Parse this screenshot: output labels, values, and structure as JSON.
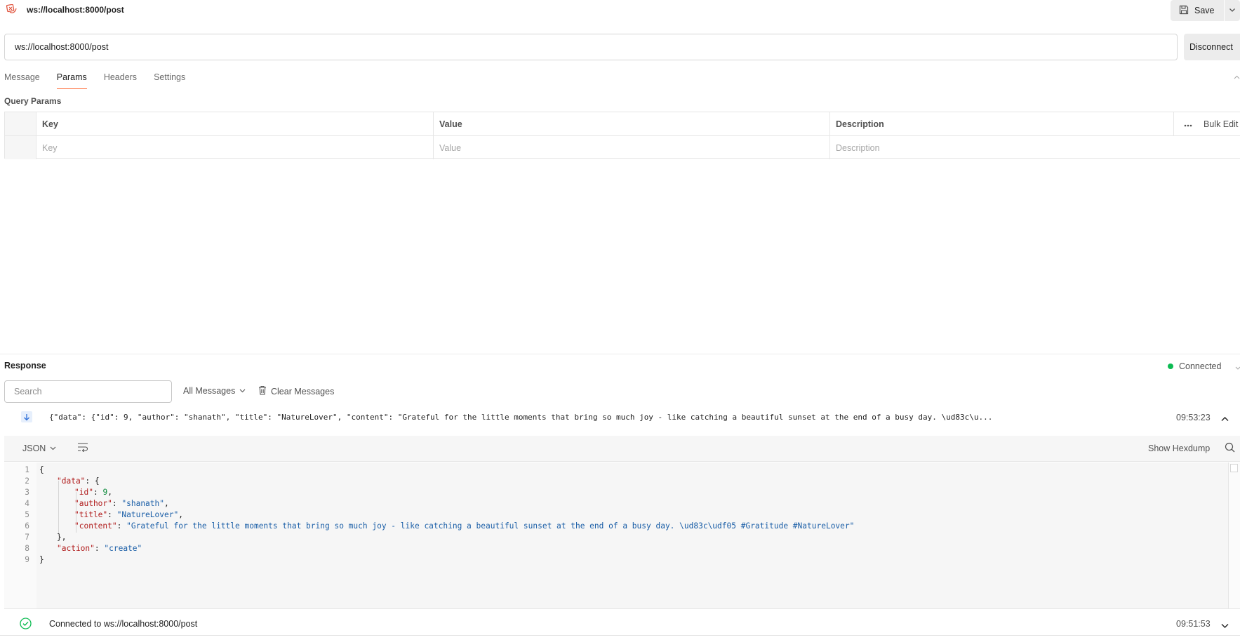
{
  "header": {
    "title": "ws://localhost:8000/post",
    "save_label": "Save"
  },
  "url_bar": {
    "value": "ws://localhost:8000/post",
    "disconnect_label": "Disconnect"
  },
  "tabs": [
    {
      "label": "Message"
    },
    {
      "label": "Params",
      "active": true
    },
    {
      "label": "Headers"
    },
    {
      "label": "Settings"
    }
  ],
  "params": {
    "section_label": "Query Params",
    "columns": [
      "Key",
      "Value",
      "Description"
    ],
    "bulk_edit_label": "Bulk Edit",
    "placeholders": {
      "key": "Key",
      "value": "Value",
      "description": "Description"
    }
  },
  "response": {
    "title": "Response",
    "status": "Connected",
    "search_placeholder": "Search",
    "filter_label": "All Messages",
    "clear_label": "Clear Messages",
    "message": {
      "preview": "{\"data\": {\"id\": 9, \"author\": \"shanath\", \"title\": \"NatureLover\", \"content\": \"Grateful for the little moments that bring so much joy - like catching a beautiful sunset at the end of a busy day. \\ud83c\\u...",
      "time": "09:53:23"
    },
    "viewer": {
      "format": "JSON",
      "hexdump_label": "Show Hexdump",
      "lines": [
        {
          "n": "1",
          "indent": 0,
          "tokens": [
            {
              "t": "p",
              "v": "{"
            }
          ]
        },
        {
          "n": "2",
          "indent": 1,
          "tokens": [
            {
              "t": "k",
              "v": "\"data\""
            },
            {
              "t": "p",
              "v": ": {"
            }
          ]
        },
        {
          "n": "3",
          "indent": 2,
          "tokens": [
            {
              "t": "k",
              "v": "\"id\""
            },
            {
              "t": "p",
              "v": ": "
            },
            {
              "t": "n",
              "v": "9"
            },
            {
              "t": "p",
              "v": ","
            }
          ]
        },
        {
          "n": "4",
          "indent": 2,
          "tokens": [
            {
              "t": "k",
              "v": "\"author\""
            },
            {
              "t": "p",
              "v": ": "
            },
            {
              "t": "s",
              "v": "\"shanath\""
            },
            {
              "t": "p",
              "v": ","
            }
          ]
        },
        {
          "n": "5",
          "indent": 2,
          "tokens": [
            {
              "t": "k",
              "v": "\"title\""
            },
            {
              "t": "p",
              "v": ": "
            },
            {
              "t": "s",
              "v": "\"NatureLover\""
            },
            {
              "t": "p",
              "v": ","
            }
          ]
        },
        {
          "n": "6",
          "indent": 2,
          "tokens": [
            {
              "t": "k",
              "v": "\"content\""
            },
            {
              "t": "p",
              "v": ": "
            },
            {
              "t": "s",
              "v": "\"Grateful for the little moments that bring so much joy - like catching a beautiful sunset at the end of a busy day. \\ud83c\\udf05 #Gratitude #NatureLover\""
            }
          ]
        },
        {
          "n": "7",
          "indent": 1,
          "tokens": [
            {
              "t": "p",
              "v": "},"
            }
          ]
        },
        {
          "n": "8",
          "indent": 1,
          "tokens": [
            {
              "t": "k",
              "v": "\"action\""
            },
            {
              "t": "p",
              "v": ": "
            },
            {
              "t": "s",
              "v": "\"create\""
            }
          ]
        },
        {
          "n": "9",
          "indent": 0,
          "tokens": [
            {
              "t": "p",
              "v": "}"
            }
          ]
        }
      ]
    },
    "connection_event": {
      "text": "Connected to ws://localhost:8000/post",
      "time": "09:51:53"
    }
  },
  "colors": {
    "accent": "#ff6c37",
    "connected": "#0cbb52",
    "json_key": "#b01b1b",
    "json_string": "#1a5ea7",
    "json_number": "#0b8a3a"
  }
}
